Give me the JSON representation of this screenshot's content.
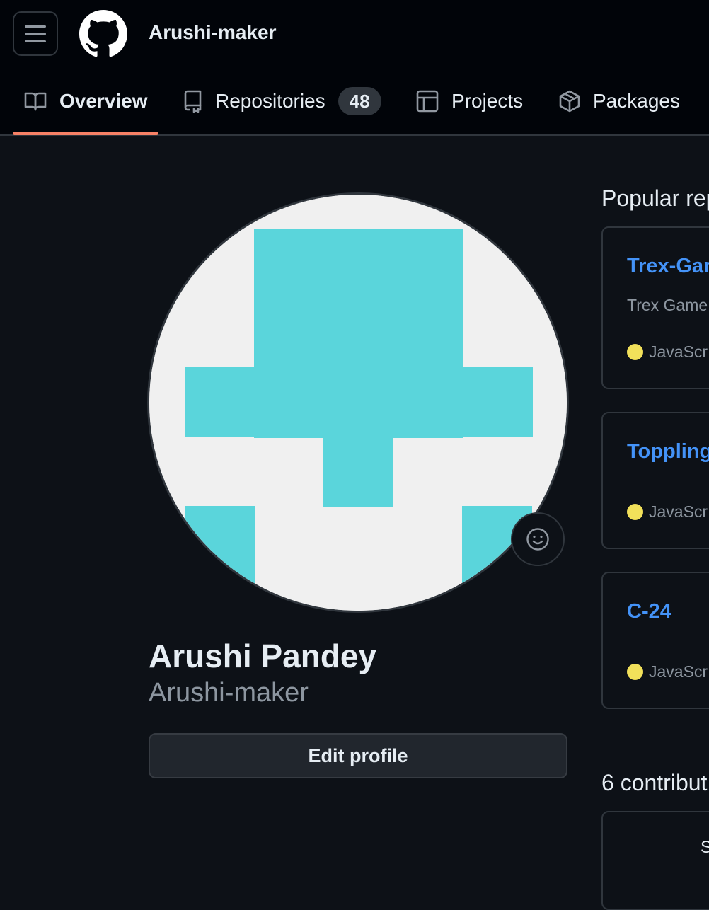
{
  "header": {
    "username": "Arushi-maker",
    "icons": {
      "menu": "hamburger-icon",
      "logo": "github-mark-icon"
    }
  },
  "tabs": [
    {
      "label": "Overview",
      "icon": "book-icon",
      "active": true
    },
    {
      "label": "Repositories",
      "icon": "repo-icon",
      "count": "48"
    },
    {
      "label": "Projects",
      "icon": "table-icon"
    },
    {
      "label": "Packages",
      "icon": "package-icon"
    }
  ],
  "profile": {
    "full_name": "Arushi Pandey",
    "login": "Arushi-maker",
    "edit_label": "Edit profile",
    "status_icon": "smiley-icon",
    "avatar_color": "#5ad5db"
  },
  "popular": {
    "title": "Popular rep",
    "repos": [
      {
        "name": "Trex-Gar",
        "description": "Trex Game",
        "language": "JavaScr"
      },
      {
        "name": "Toppling",
        "description": "",
        "language": "JavaScr"
      },
      {
        "name": "C-24",
        "description": "",
        "language": "JavaScr"
      }
    ]
  },
  "contributions": {
    "title": "6 contribut",
    "fragment": "S"
  },
  "colors": {
    "background": "#0d1117",
    "header": "#010409",
    "accent_underline": "#f78166",
    "link": "#4493f8",
    "javascript": "#f1e05a"
  }
}
